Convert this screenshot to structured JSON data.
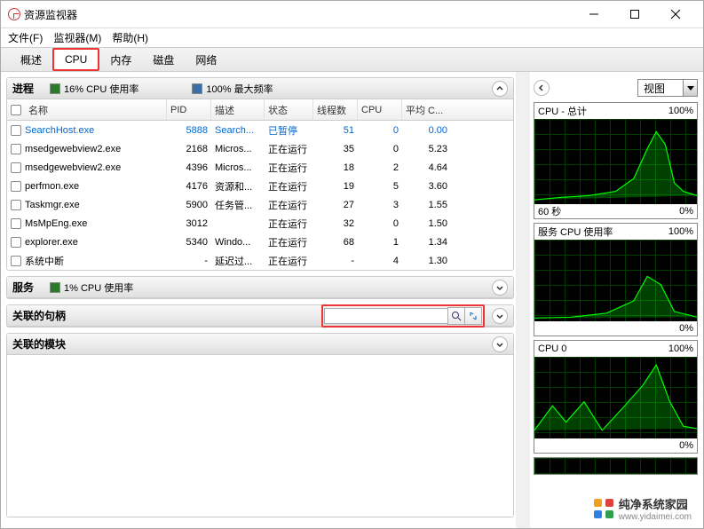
{
  "window": {
    "title": "资源监视器"
  },
  "menu": {
    "file": "文件(F)",
    "monitor": "监视器(M)",
    "help": "帮助(H)"
  },
  "tabs": {
    "overview": "概述",
    "cpu": "CPU",
    "memory": "内存",
    "disk": "磁盘",
    "network": "网络"
  },
  "processes": {
    "title": "进程",
    "cpu_usage_label": "16% CPU 使用率",
    "max_freq_label": "100% 最大频率",
    "columns": {
      "name": "名称",
      "pid": "PID",
      "desc": "描述",
      "state": "状态",
      "threads": "线程数",
      "cpu": "CPU",
      "avg": "平均 C..."
    },
    "rows": [
      {
        "name": "SearchHost.exe",
        "pid": "5888",
        "desc": "Search...",
        "state": "已暂停",
        "threads": "51",
        "cpu": "0",
        "avg": "0.00",
        "link": true
      },
      {
        "name": "msedgewebview2.exe",
        "pid": "2168",
        "desc": "Micros...",
        "state": "正在运行",
        "threads": "35",
        "cpu": "0",
        "avg": "5.23"
      },
      {
        "name": "msedgewebview2.exe",
        "pid": "4396",
        "desc": "Micros...",
        "state": "正在运行",
        "threads": "18",
        "cpu": "2",
        "avg": "4.64"
      },
      {
        "name": "perfmon.exe",
        "pid": "4176",
        "desc": "资源和...",
        "state": "正在运行",
        "threads": "19",
        "cpu": "5",
        "avg": "3.60"
      },
      {
        "name": "Taskmgr.exe",
        "pid": "5900",
        "desc": "任务管...",
        "state": "正在运行",
        "threads": "27",
        "cpu": "3",
        "avg": "1.55"
      },
      {
        "name": "MsMpEng.exe",
        "pid": "3012",
        "desc": "",
        "state": "正在运行",
        "threads": "32",
        "cpu": "0",
        "avg": "1.50"
      },
      {
        "name": "explorer.exe",
        "pid": "5340",
        "desc": "Windo...",
        "state": "正在运行",
        "threads": "68",
        "cpu": "1",
        "avg": "1.34"
      },
      {
        "name": "系统中断",
        "pid": "-",
        "desc": "延迟过...",
        "state": "正在运行",
        "threads": "-",
        "cpu": "4",
        "avg": "1.30"
      }
    ]
  },
  "services": {
    "title": "服务",
    "cpu_label": "1% CPU 使用率"
  },
  "handles": {
    "title": "关联的句柄"
  },
  "modules": {
    "title": "关联的模块"
  },
  "graphs": {
    "view_label": "视图",
    "total": {
      "title": "CPU - 总计",
      "max": "100%",
      "footer_left": "60 秒",
      "footer_right": "0%"
    },
    "svc": {
      "title": "服务 CPU 使用率",
      "max": "100%",
      "footer_right": "0%"
    },
    "cpu0": {
      "title": "CPU 0",
      "max": "100%",
      "footer_right": "0%"
    }
  },
  "watermark": {
    "text": "纯净系统家园",
    "url": "www.yidaimei.com"
  }
}
